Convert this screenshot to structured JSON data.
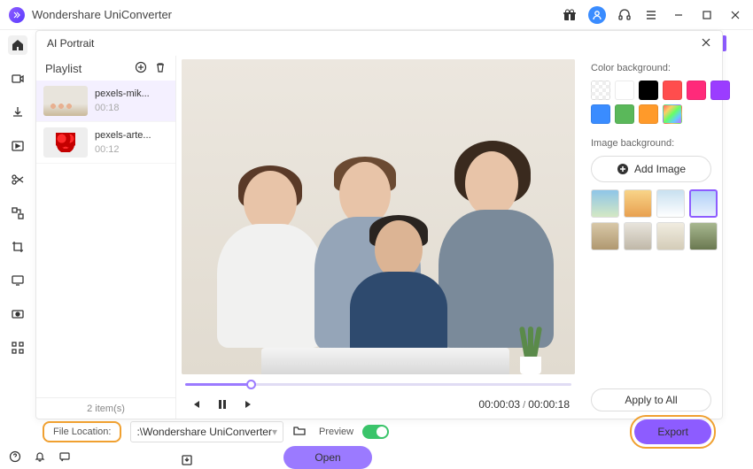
{
  "app": {
    "title": "Wondershare UniConverter"
  },
  "modal": {
    "title": "AI Portrait"
  },
  "playlist": {
    "title": "Playlist",
    "items": [
      {
        "name": "pexels-mik...",
        "duration": "00:18"
      },
      {
        "name": "pexels-arte...",
        "duration": "00:12"
      }
    ],
    "count_label": "2 item(s)"
  },
  "player": {
    "current_time": "00:00:03",
    "total_time": "00:00:18"
  },
  "options": {
    "color_bg_label": "Color background:",
    "image_bg_label": "Image background:",
    "add_image_label": "Add Image",
    "apply_all_label": "Apply to All",
    "color_swatches": [
      "transparent",
      "#ffffff",
      "#000000",
      "#ff4d4d",
      "#ff2a7a",
      "#9b3cff",
      "#3a8cff",
      "#5ab85a",
      "#ff9a2a",
      "rainbow"
    ]
  },
  "footer": {
    "file_location_label": "File Location:",
    "file_location_path": ":\\Wondershare UniConverter",
    "preview_label": "Preview",
    "preview_on": true,
    "export_label": "Export",
    "open_label": "Open"
  }
}
